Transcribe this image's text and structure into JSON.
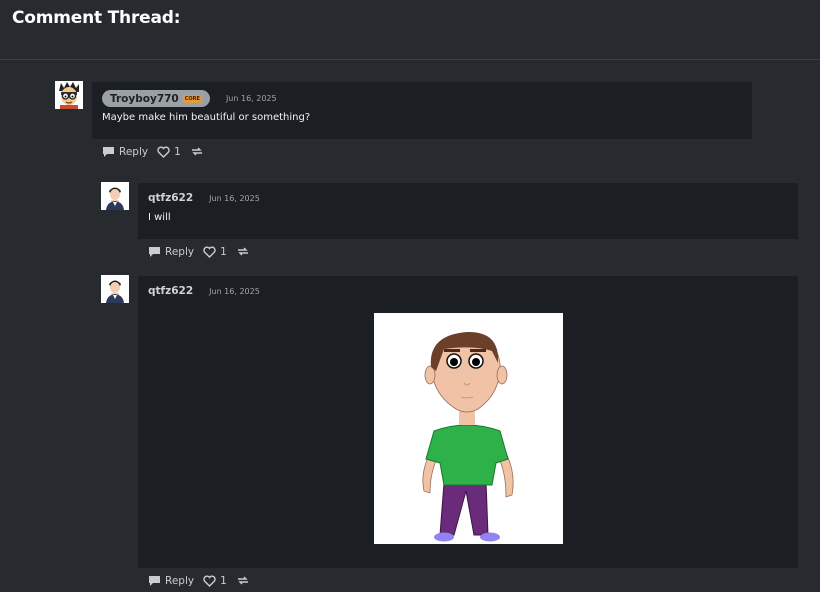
{
  "page": {
    "title": "Comment Thread:"
  },
  "comments": [
    {
      "username": "Troyboy770",
      "badge": "CORE",
      "date": "Jun 16, 2025",
      "text": "Maybe make him beautiful or something?",
      "reply_label": "Reply",
      "likes": "1"
    },
    {
      "username": "qtfz622",
      "date": "Jun 16, 2025",
      "text": "I will",
      "reply_label": "Reply",
      "likes": "1"
    },
    {
      "username": "qtfz622",
      "date": "Jun 16, 2025",
      "text": "",
      "reply_label": "Reply",
      "likes": "1"
    }
  ],
  "colors": {
    "background": "#272b30",
    "bubble": "#1b1e22",
    "chip": "#9aa0a6",
    "core_badge": "#e49a3c"
  },
  "icons": [
    "comment-icon",
    "heart-icon",
    "repost-icon"
  ]
}
